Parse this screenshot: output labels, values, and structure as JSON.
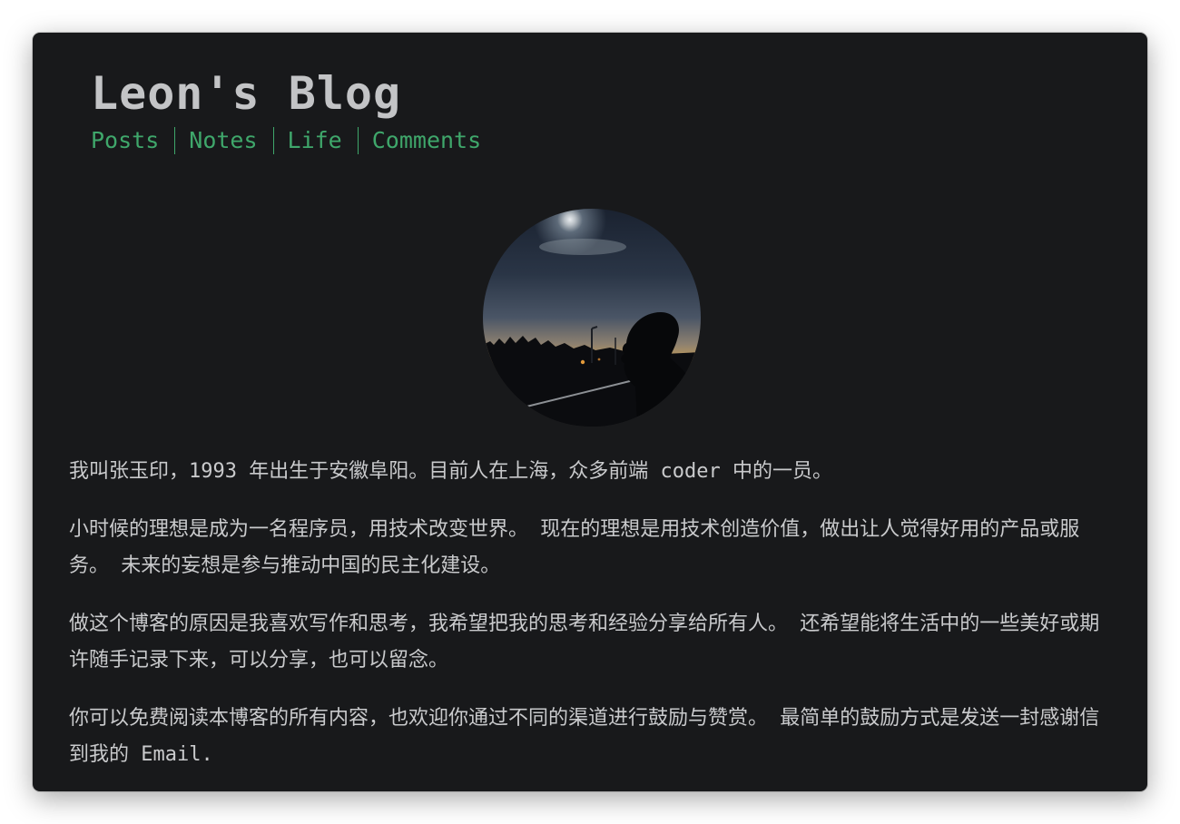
{
  "site": {
    "title": "Leon's Blog"
  },
  "nav": {
    "items": [
      {
        "label": "Posts"
      },
      {
        "label": "Notes"
      },
      {
        "label": "Life"
      },
      {
        "label": "Comments"
      }
    ]
  },
  "about": {
    "avatar_icon": "avatar-silhouette-photo",
    "paragraphs": [
      "我叫张玉印，1993 年出生于安徽阜阳。目前人在上海，众多前端 coder 中的一员。",
      "小时候的理想是成为一名程序员，用技术改变世界。 现在的理想是用技术创造价值，做出让人觉得好用的产品或服务。 未来的妄想是参与推动中国的民主化建设。",
      "做这个博客的原因是我喜欢写作和思考，我希望把我的思考和经验分享给所有人。 还希望能将生活中的一些美好或期许随手记录下来，可以分享，也可以留念。",
      "你可以免费阅读本博客的所有内容，也欢迎你通过不同的渠道进行鼓励与赞赏。 最简单的鼓励方式是发送一封感谢信到我的 Email."
    ]
  },
  "colors": {
    "background": "#18191b",
    "title": "#c3c4c6",
    "nav_accent": "#3fa76b",
    "body_text": "#c9cacc"
  }
}
